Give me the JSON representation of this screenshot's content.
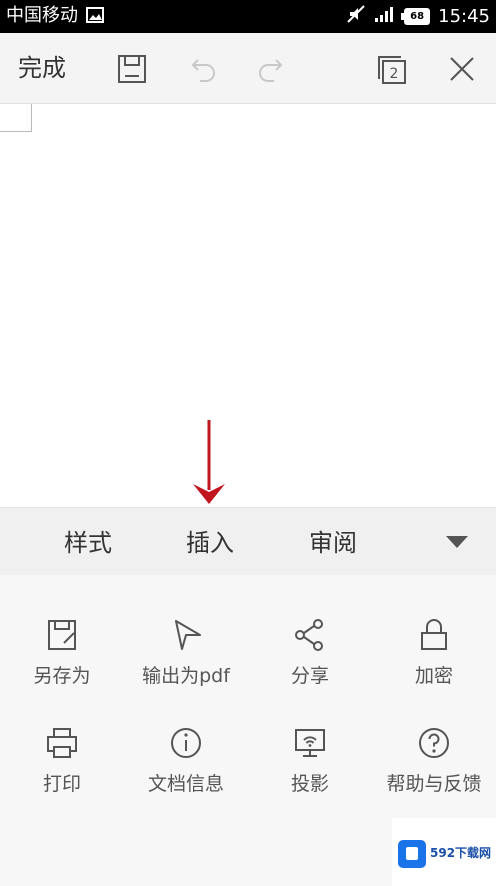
{
  "status_bar": {
    "carrier": "中国移动",
    "battery": "68",
    "time": "15:45",
    "icons": [
      "image-icon",
      "mute-icon",
      "signal-icon",
      "battery-icon"
    ]
  },
  "toolbar": {
    "done_label": "完成",
    "page_count": "2",
    "icons": [
      "save-icon",
      "undo-icon",
      "redo-icon",
      "pages-icon",
      "close-icon"
    ]
  },
  "tabs": {
    "items": [
      "样式",
      "插入",
      "审阅"
    ],
    "toggle_icon": "triangle-down-icon"
  },
  "menu": {
    "items": [
      {
        "label": "另存为",
        "icon": "save-as-icon"
      },
      {
        "label": "输出为pdf",
        "icon": "export-pdf-icon"
      },
      {
        "label": "分享",
        "icon": "share-icon"
      },
      {
        "label": "加密",
        "icon": "lock-icon"
      },
      {
        "label": "打印",
        "icon": "print-icon"
      },
      {
        "label": "文档信息",
        "icon": "info-icon"
      },
      {
        "label": "投影",
        "icon": "projection-icon"
      },
      {
        "label": "帮助与反馈",
        "icon": "help-icon"
      }
    ]
  },
  "watermark": {
    "text": "592下载网"
  },
  "colors": {
    "arrow": "#c0161d",
    "icon": "#555555",
    "panel_bg": "#f7f7f7"
  }
}
